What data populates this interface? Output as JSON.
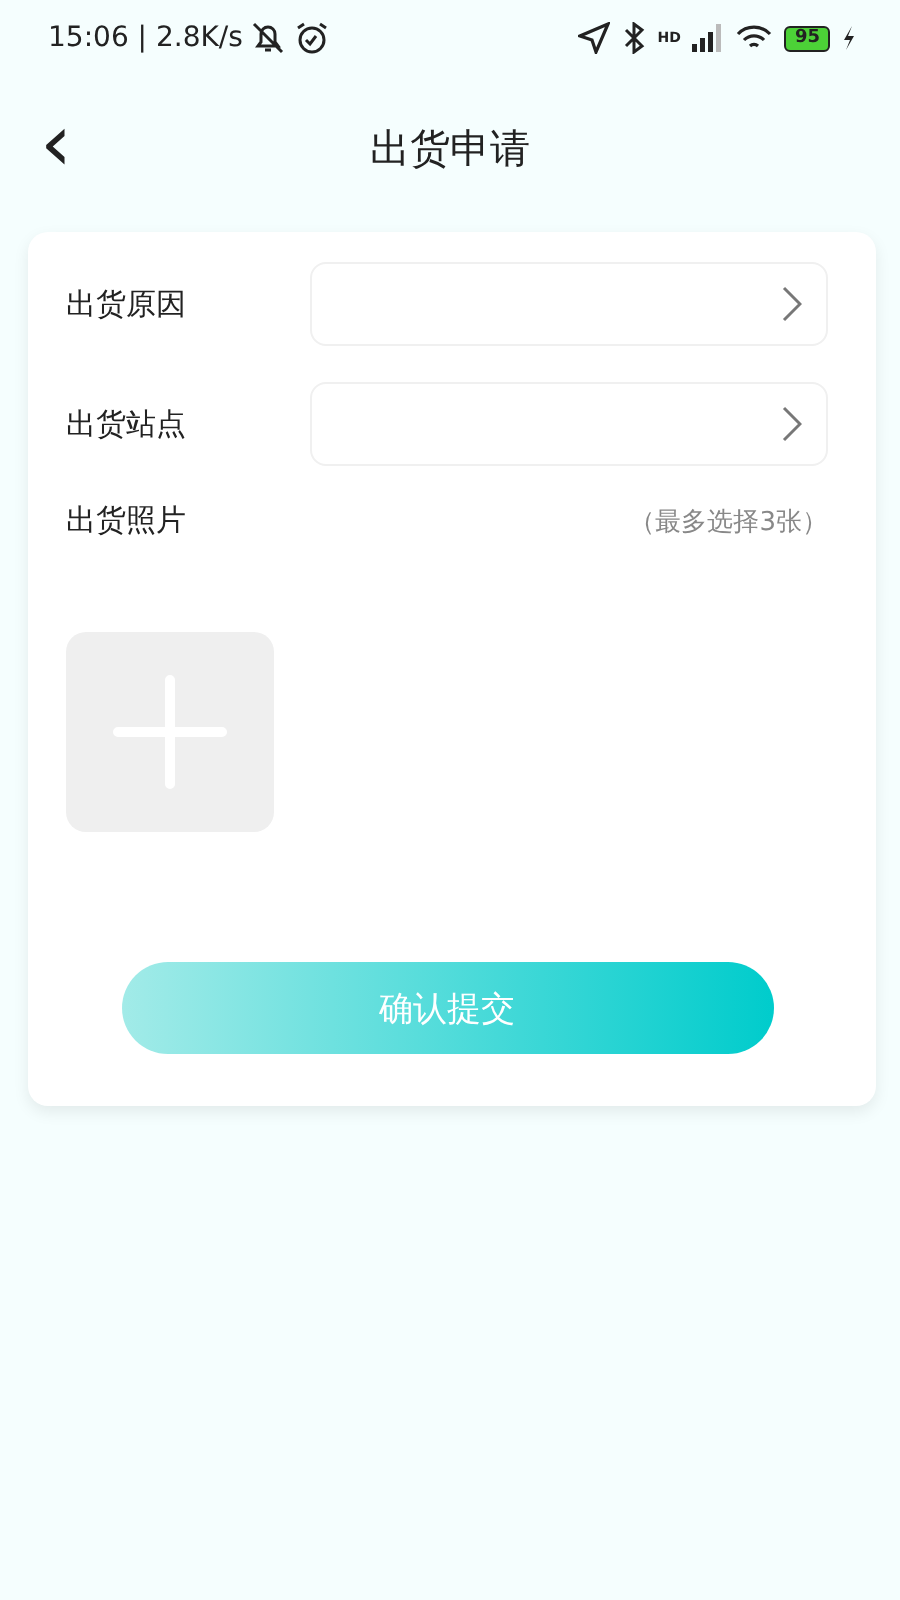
{
  "status_bar": {
    "time": "15:06 | 2.8K/s",
    "network_label": "HD",
    "battery": "95"
  },
  "header": {
    "back": "‹",
    "title": "出货申请"
  },
  "form": {
    "fields": [
      {
        "label": "出货原因",
        "kind": "select"
      },
      {
        "label": "出货站点",
        "kind": "select"
      }
    ],
    "photos": {
      "label": "出货照片",
      "hint": "（最多选择3张）"
    },
    "submit": "确认提交"
  }
}
